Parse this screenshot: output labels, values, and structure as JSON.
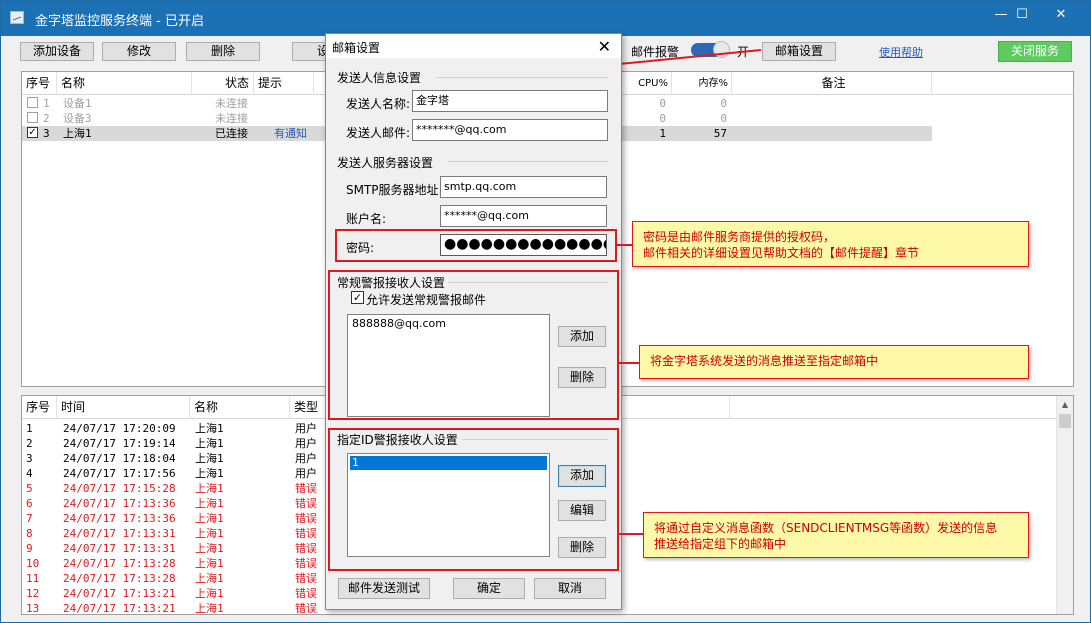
{
  "window": {
    "title": "金字塔监控服务终端 - 已开启",
    "minimize_glyph": "—",
    "maximize_glyph": "☐",
    "close_glyph": "✕"
  },
  "toolbar": {
    "add_device": "添加设备",
    "modify": "修改",
    "delete": "删除",
    "partial_button": "设",
    "mail_alarm_label": "邮件报警",
    "toggle_state": "开",
    "mail_settings": "邮箱设置",
    "help_link": "使用帮助",
    "close_service": "关闭服务"
  },
  "device_table": {
    "columns": [
      "序号",
      "名称",
      "状态",
      "提示",
      "CPU%",
      "内存%",
      "备注"
    ],
    "rows": [
      {
        "checked": false,
        "no": "1",
        "name": "设备1",
        "status": "未连接",
        "tip": "",
        "cpu": "0",
        "mem": "0",
        "note": ""
      },
      {
        "checked": false,
        "no": "2",
        "name": "设备3",
        "status": "未连接",
        "tip": "",
        "cpu": "0",
        "mem": "0",
        "note": ""
      },
      {
        "checked": true,
        "no": "3",
        "name": "上海1",
        "status": "已连接",
        "tip": "有通知",
        "cpu": "1",
        "mem": "57",
        "note": ""
      }
    ]
  },
  "log_table": {
    "columns": [
      "序号",
      "时间",
      "名称",
      "类型"
    ],
    "rows": [
      {
        "no": "1",
        "time": "24/07/17 17:20:09",
        "name": "上海1",
        "type": "用户",
        "error": false
      },
      {
        "no": "2",
        "time": "24/07/17 17:19:14",
        "name": "上海1",
        "type": "用户",
        "error": false
      },
      {
        "no": "3",
        "time": "24/07/17 17:18:04",
        "name": "上海1",
        "type": "用户",
        "error": false
      },
      {
        "no": "4",
        "time": "24/07/17 17:17:56",
        "name": "上海1",
        "type": "用户",
        "error": false
      },
      {
        "no": "5",
        "time": "24/07/17 17:15:28",
        "name": "上海1",
        "type": "错误",
        "error": true
      },
      {
        "no": "6",
        "time": "24/07/17 17:13:36",
        "name": "上海1",
        "type": "错误",
        "error": true
      },
      {
        "no": "7",
        "time": "24/07/17 17:13:36",
        "name": "上海1",
        "type": "错误",
        "error": true
      },
      {
        "no": "8",
        "time": "24/07/17 17:13:31",
        "name": "上海1",
        "type": "错误",
        "error": true
      },
      {
        "no": "9",
        "time": "24/07/17 17:13:31",
        "name": "上海1",
        "type": "错误",
        "error": true
      },
      {
        "no": "10",
        "time": "24/07/17 17:13:28",
        "name": "上海1",
        "type": "错误",
        "error": true
      },
      {
        "no": "11",
        "time": "24/07/17 17:13:28",
        "name": "上海1",
        "type": "错误",
        "error": true
      },
      {
        "no": "12",
        "time": "24/07/17 17:13:21",
        "name": "上海1",
        "type": "错误",
        "error": true
      },
      {
        "no": "13",
        "time": "24/07/17 17:13:21",
        "name": "上海1",
        "type": "错误",
        "error": true
      }
    ]
  },
  "dialog": {
    "title": "邮箱设置",
    "close_glyph": "✕",
    "sender_group": "发送人信息设置",
    "sender_name_label": "发送人名称:",
    "sender_name_value": "金字塔",
    "sender_mail_label": "发送人邮件:",
    "sender_mail_value": "*******@qq.com",
    "server_group": "发送人服务器设置",
    "smtp_label": "SMTP服务器地址:",
    "smtp_value": "smtp.qq.com",
    "account_label": "账户名:",
    "account_value": "******@qq.com",
    "password_label": "密码:",
    "password_value": "●●●●●●●●●●●●●●●●",
    "normal_group": "常规警报接收人设置",
    "allow_normal_label": "允许发送常规警报邮件",
    "allow_normal_checked": true,
    "normal_list": [
      "888888@qq.com"
    ],
    "add_label": "添加",
    "delete_label": "删除",
    "id_group": "指定ID警报接收人设置",
    "id_list": [
      "1"
    ],
    "edit_label": "编辑",
    "test_label": "邮件发送测试",
    "ok_label": "确定",
    "cancel_label": "取消"
  },
  "callouts": {
    "password_note_line1": "密码是由邮件服务商提供的授权码，",
    "password_note_line2": "邮件相关的详细设置见帮助文档的【邮件提醒】章节",
    "normal_note": "将金字塔系统发送的消息推送至指定邮箱中",
    "id_note_line1": "将通过自定义消息函数（SENDCLIENTMSG等函数）发送的信息",
    "id_note_line2": "推送给指定组下的邮箱中"
  },
  "colors": {
    "titlebar": "#1c71b5",
    "accent_green": "#5ecb5e",
    "annotation_red": "#e0191f",
    "callout_bg": "#fef9a8",
    "error_text": "#e0191f",
    "selected_row": "#d9d9d9"
  }
}
